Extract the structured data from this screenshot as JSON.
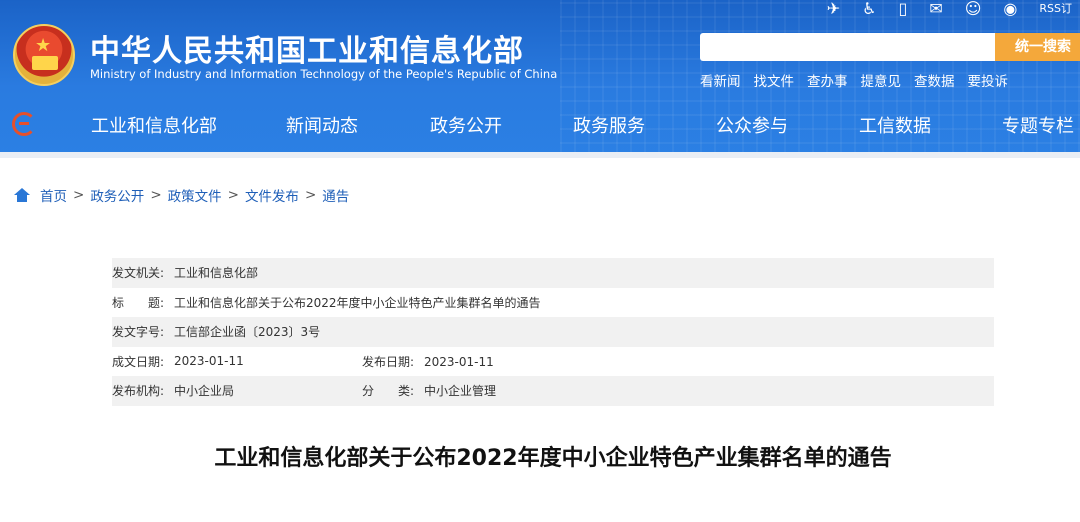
{
  "header": {
    "site_title": "中华人民共和国工业和信息化部",
    "site_subtitle": "Ministry of Industry and Information Technology of the People's Republic of China",
    "top_icons": [
      "rocket-icon",
      "accessibility-icon",
      "mobile-icon",
      "mail-icon",
      "wechat-icon",
      "weibo-icon"
    ],
    "rss_label": "RSS订",
    "search": {
      "placeholder": "",
      "button_label": "统一搜索"
    },
    "quick_links": [
      "看新闻",
      "找文件",
      "查办事",
      "提意见",
      "查数据",
      "要投诉"
    ]
  },
  "nav": {
    "items": [
      "工业和信息化部",
      "新闻动态",
      "政务公开",
      "政务服务",
      "公众参与",
      "工信数据",
      "专题专栏"
    ]
  },
  "breadcrumb": {
    "items": [
      "首页",
      "政务公开",
      "政策文件",
      "文件发布",
      "通告"
    ],
    "separator": ">"
  },
  "meta": {
    "issuer_label": "发文机关:",
    "issuer": "工业和信息化部",
    "title_label": "标　　题:",
    "title": "工业和信息化部关于公布2022年度中小企业特色产业集群名单的通告",
    "doc_no_label": "发文字号:",
    "doc_no": "工信部企业函〔2023〕3号",
    "created_label": "成文日期:",
    "created": "2023-01-11",
    "published_label": "发布日期:",
    "published": "2023-01-11",
    "org_label": "发布机构:",
    "org": "中小企业局",
    "category_label": "分　　类:",
    "category": "中小企业管理"
  },
  "article": {
    "title": "工业和信息化部关于公布2022年度中小企业特色产业集群名单的通告"
  },
  "colors": {
    "header_blue": "#2a7be0",
    "search_orange": "#f4a83b",
    "link_blue": "#1f5fb8",
    "meta_shade": "#f1f1f1"
  }
}
